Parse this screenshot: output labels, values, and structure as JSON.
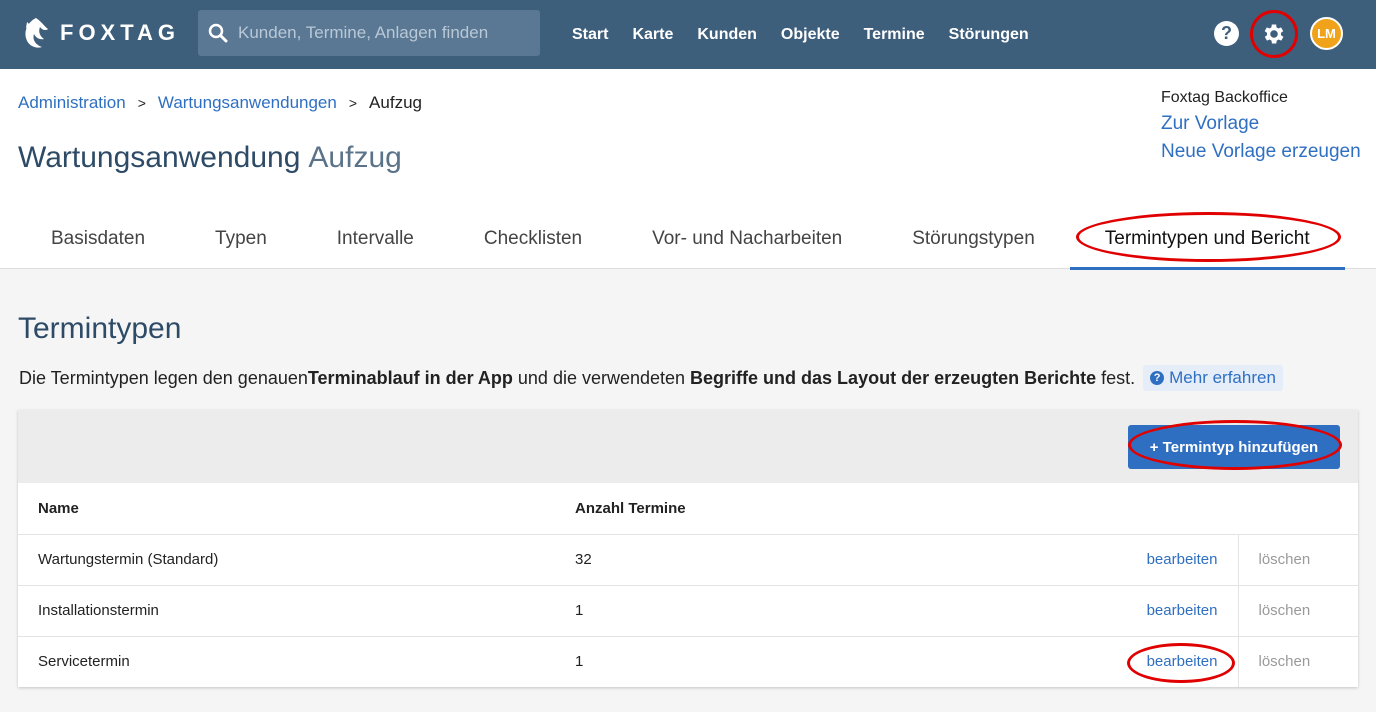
{
  "brand": {
    "name": "FOXTAG"
  },
  "search": {
    "placeholder": "Kunden, Termine, Anlagen finden"
  },
  "nav": [
    "Start",
    "Karte",
    "Kunden",
    "Objekte",
    "Termine",
    "Störungen"
  ],
  "user": {
    "initials": "LM",
    "avatar_color": "#f0a31a"
  },
  "breadcrumb": {
    "root": "Administration",
    "parent": "Wartungsanwendungen",
    "current": "Aufzug"
  },
  "page": {
    "title": "Wartungsanwendung",
    "subtitle": "Aufzug"
  },
  "side": {
    "label": "Foxtag Backoffice",
    "link1": "Zur Vorlage",
    "link2": "Neue Vorlage erzeugen"
  },
  "tabs": [
    "Basisdaten",
    "Typen",
    "Intervalle",
    "Checklisten",
    "Vor- und Nacharbeiten",
    "Störungstypen",
    "Termintypen und Bericht"
  ],
  "section": {
    "title": "Termintypen",
    "desc_1": "Die Termintypen legen den genauen ",
    "desc_b1": "Terminablauf in der App",
    "desc_2": " und die verwendeten ",
    "desc_b2": "Begriffe und das Layout der erzeugten Berichte",
    "desc_3": " fest.",
    "more": "Mehr erfahren"
  },
  "table": {
    "add_button": "+ Termintyp hinzufügen",
    "headers": {
      "name": "Name",
      "count": "Anzahl Termine"
    },
    "rows": [
      {
        "name": "Wartungstermin (Standard)",
        "count": "32",
        "edit": "bearbeiten",
        "delete": "löschen"
      },
      {
        "name": "Installationstermin",
        "count": "1",
        "edit": "bearbeiten",
        "delete": "löschen"
      },
      {
        "name": "Servicetermin",
        "count": "1",
        "edit": "bearbeiten",
        "delete": "löschen"
      }
    ]
  },
  "colors": {
    "topbar": "#3e5f7c",
    "accent": "#2f6fc2",
    "highlight_ring": "#e00000"
  }
}
